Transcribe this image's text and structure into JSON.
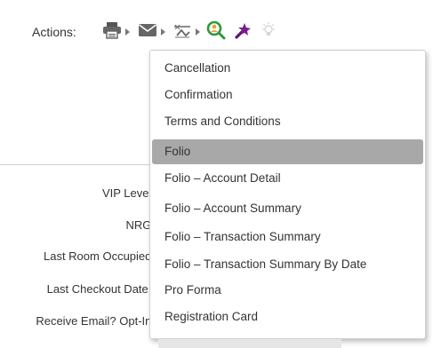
{
  "toolbar": {
    "label": "Actions:",
    "tools": [
      {
        "icon": "printer-icon",
        "has_dropdown": true
      },
      {
        "icon": "mail-icon",
        "has_dropdown": true
      },
      {
        "icon": "fax-icon",
        "has_dropdown": true
      },
      {
        "icon": "search-person-icon",
        "has_dropdown": false
      },
      {
        "icon": "magic-wand-icon",
        "has_dropdown": false
      },
      {
        "icon": "lightbulb-icon",
        "has_dropdown": false
      }
    ]
  },
  "fields": [
    {
      "label": "VIP Level:"
    },
    {
      "label": "NRG:"
    },
    {
      "label": "Last Room Occupied:"
    },
    {
      "label": "Last Checkout Date :"
    },
    {
      "label": "Receive Email? Opt-In:"
    }
  ],
  "menu": {
    "items": [
      {
        "label": "Cancellation"
      },
      {
        "label": "Confirmation"
      },
      {
        "label": "Terms and Conditions"
      },
      {
        "label": "Folio",
        "selected": true
      },
      {
        "label": "Folio – Account Detail"
      },
      {
        "label": "Folio – Account Summary"
      },
      {
        "label": "Folio – Transaction Summary"
      },
      {
        "label": "Folio – Transaction Summary By Date"
      },
      {
        "label": "Pro Forma"
      },
      {
        "label": "Registration Card"
      }
    ]
  },
  "colors": {
    "selected_bg": "#a8a8a8",
    "icon_gray": "#666666",
    "search_green": "#2e9a3a",
    "wand_purple": "#7a1f8c"
  }
}
